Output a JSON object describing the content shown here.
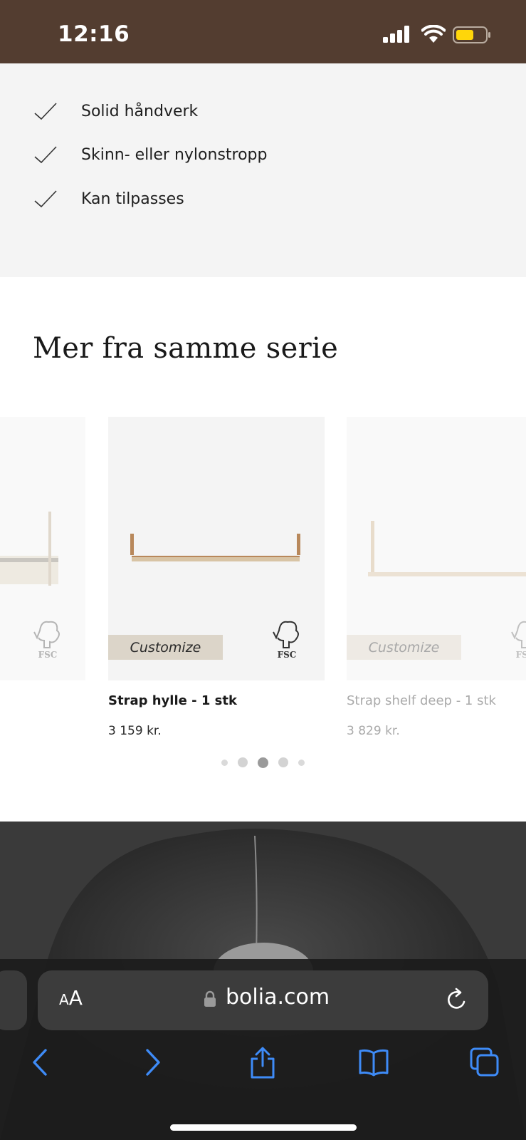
{
  "status_bar": {
    "time": "12:16",
    "background": "#533d30",
    "battery_color": "#ffd60a"
  },
  "features": {
    "items": [
      {
        "label": "Solid håndverk",
        "icon": "checkmark-icon"
      },
      {
        "label": "Skinn- eller nylonstropp",
        "icon": "checkmark-icon"
      },
      {
        "label": "Kan tilpasses",
        "icon": "checkmark-icon"
      }
    ]
  },
  "series": {
    "title": "Mer fra samme serie",
    "products": [
      {
        "name": "",
        "price": "",
        "customize_label": "",
        "badge": "FSC",
        "visible": "partial-left"
      },
      {
        "name": "Strap hylle - 1 stk",
        "price": "3 159 kr.",
        "customize_label": "Customize",
        "badge": "FSC"
      },
      {
        "name": "Strap shelf deep - 1 stk",
        "price": "3 829 kr.",
        "customize_label": "Customize",
        "badge": "FSC"
      }
    ],
    "dots": {
      "count": 5,
      "active_index": 2
    }
  },
  "browser": {
    "text_size_label_small": "A",
    "text_size_label_large": "A",
    "url": "bolia.com",
    "accent_color": "#3e8bf7"
  }
}
